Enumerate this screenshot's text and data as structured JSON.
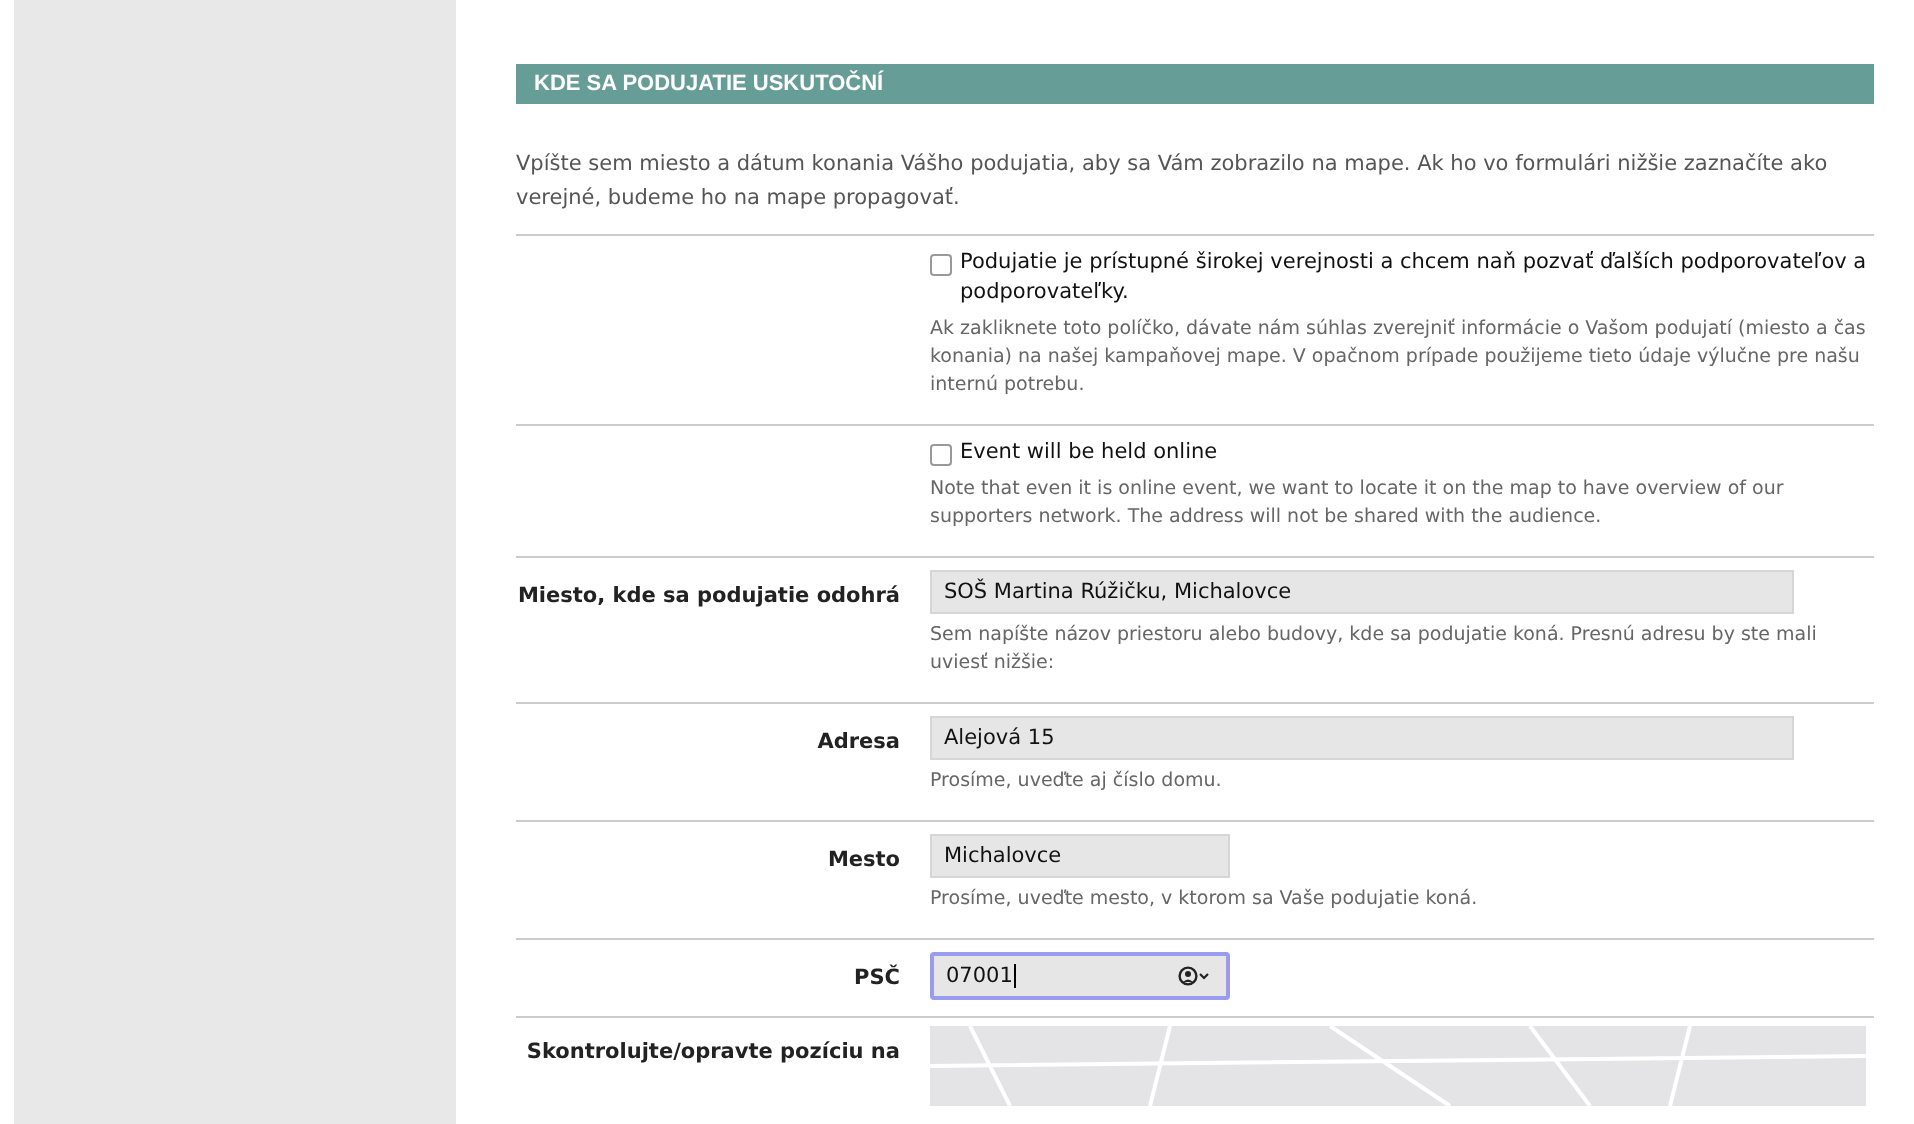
{
  "section": {
    "title": "KDE SA PODUJATIE USKUTOČNÍ",
    "intro": "Vpíšte sem miesto a dátum konania Vášho podujatia, aby sa Vám zobrazilo na mape. Ak ho vo formulári nižšie zaznačíte ako verejné, budeme ho na mape propagovať."
  },
  "rows": [
    {
      "kind": "checkbox",
      "label": "Podujatie je prístupné širokej verejnosti a chcem naň pozvať ďalších podporovateľov a podporovateľky.",
      "checked": false,
      "help": "Ak zakliknete toto políčko, dávate nám súhlas zverejniť informácie o Vašom podujatí (miesto a čas konania) na našej kampaňovej mape. V opačnom prípade použijeme tieto údaje výlučne pre našu internú potrebu."
    },
    {
      "kind": "checkbox",
      "label": "Event will be held online",
      "checked": false,
      "help": "Note that even it is online event, we want to locate it on the map to have overview of our supporters network. The address will not be shared with the audience."
    },
    {
      "kind": "text",
      "label": "Miesto, kde sa podujatie odohrá",
      "value": "SOŠ Martina Rúžičku, Michalovce",
      "focused": false,
      "help": "Sem napíšte názov priestoru alebo budovy, kde sa podujatie koná. Presnú adresu by ste mali uviesť nižšie:"
    },
    {
      "kind": "text",
      "label": "Adresa",
      "value": "Alejová 15",
      "focused": false,
      "help": "Prosíme, uveďte aj číslo domu."
    },
    {
      "kind": "short-text",
      "label": "Mesto",
      "value": "Michalovce",
      "focused": false,
      "help": "Prosíme, uveďte mesto, v ktorom sa Vaše podujatie koná."
    },
    {
      "kind": "short-text",
      "label": "PSČ",
      "value": "07001",
      "focused": true,
      "autofill": true
    },
    {
      "kind": "map",
      "label": "Skontrolujte/opravte pozíciu na"
    }
  ]
}
